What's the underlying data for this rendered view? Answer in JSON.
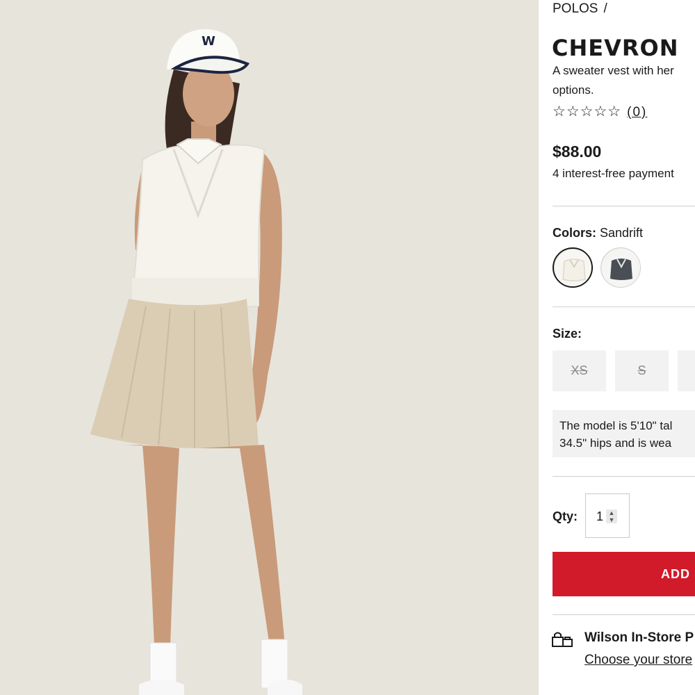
{
  "breadcrumb": {
    "category": "POLOS",
    "separator": "/"
  },
  "product": {
    "title": "CHEVRON",
    "description_line1": "A sweater vest with her",
    "description_line2": "options.",
    "rating_stars": "☆☆☆☆☆",
    "review_count": "(0)",
    "price": "$88.00",
    "installments": "4 interest-free payment"
  },
  "colors": {
    "label": "Colors:",
    "selected": "Sandrift",
    "swatches": [
      {
        "name": "Sandrift",
        "color": "#f3f0e8"
      },
      {
        "name": "Charcoal",
        "color": "#4a4f55"
      }
    ]
  },
  "size": {
    "label": "Size:",
    "options": [
      "XS",
      "S"
    ]
  },
  "model_note": {
    "line1": "The model is 5'10\" tal",
    "line2": "34.5\" hips and is wea"
  },
  "quantity": {
    "label": "Qty:",
    "value": "1"
  },
  "cart": {
    "add_label": "ADD"
  },
  "store": {
    "title": "Wilson In-Store P",
    "link": "Choose your store"
  },
  "theme": {
    "accent": "#d11a2a",
    "photo_bg": "#e7e4dc"
  }
}
